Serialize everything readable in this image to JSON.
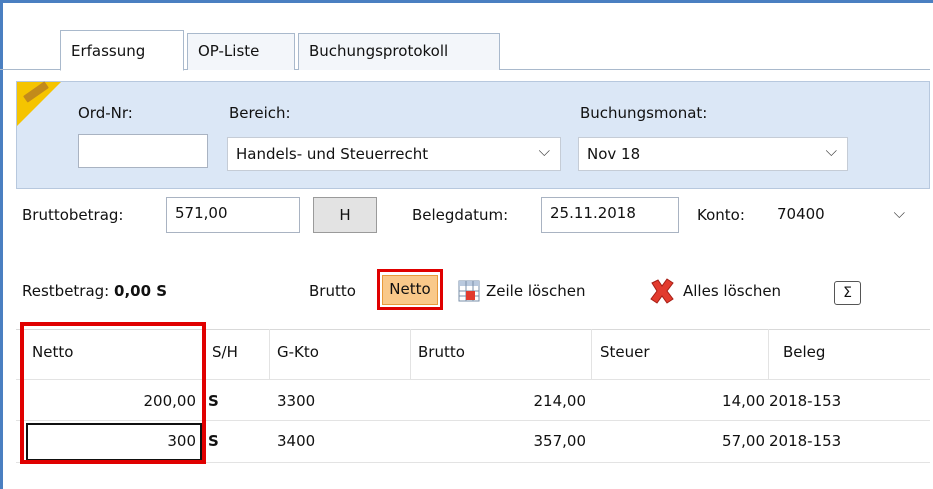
{
  "tabs": [
    {
      "label": "Erfassung",
      "active": true
    },
    {
      "label": "OP-Liste",
      "active": false
    },
    {
      "label": "Buchungsprotokoll",
      "active": false
    }
  ],
  "header": {
    "ord_nr_label": "Ord-Nr:",
    "ord_nr_value": "",
    "bereich_label": "Bereich:",
    "bereich_value": "Handels- und Steuerrecht",
    "monat_label": "Buchungsmonat:",
    "monat_value": "Nov 18"
  },
  "row2": {
    "brutto_label": "Bruttobetrag:",
    "brutto_value": "571,00",
    "h_button": "H",
    "beleg_label": "Belegdatum:",
    "beleg_value": "25.11.2018",
    "konto_label": "Konto:",
    "konto_value": "70400"
  },
  "toolbar": {
    "rest_label": "Restbetrag:",
    "rest_value": "0,00 S",
    "brutto": "Brutto",
    "netto": "Netto",
    "zeile_loeschen": "Zeile löschen",
    "alles_loeschen": "Alles löschen",
    "sigma": "Σ"
  },
  "table": {
    "columns": [
      "Netto",
      "S/H",
      "G-Kto",
      "Brutto",
      "Steuer",
      "Beleg"
    ],
    "rows": [
      [
        "200,00",
        "S",
        "3300",
        "214,00",
        "14,00",
        "2018-153"
      ],
      [
        "300",
        "S",
        "3400",
        "357,00",
        "57,00",
        "2018-153"
      ]
    ]
  },
  "colors": {
    "highlight_red": "#e00000",
    "header_bg": "#dbe7f6",
    "netto_active_bg": "#f9c98a",
    "window_border": "#4a7fc1"
  }
}
